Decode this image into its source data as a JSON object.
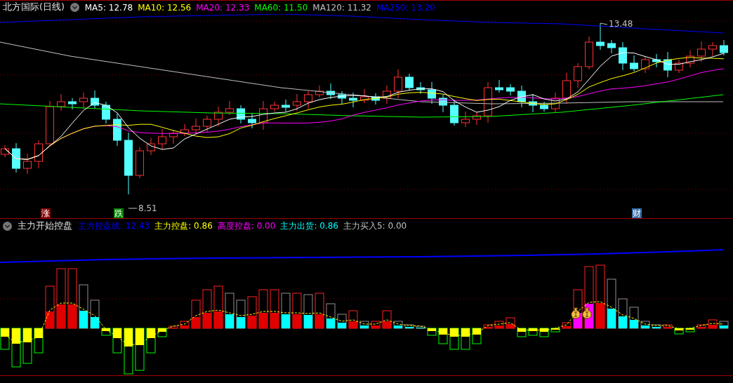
{
  "price_chart": {
    "title": "北方国际(日线)",
    "moving_averages": [
      {
        "label": "MA5: 12.78",
        "color": "#ffffff"
      },
      {
        "label": "MA10: 12.56",
        "color": "#ffff00"
      },
      {
        "label": "MA20: 12.33",
        "color": "#ff00ff"
      },
      {
        "label": "MA60: 11.50",
        "color": "#00ff00"
      },
      {
        "label": "MA120: 11.32",
        "color": "#c0c0c0"
      },
      {
        "label": "MA250: 13.20",
        "color": "#0000ff"
      }
    ],
    "high_label": "13.48",
    "low_label": "8.51",
    "signals": [
      {
        "text": "涨",
        "color": "#8b0000"
      },
      {
        "text": "跌",
        "color": "#008000"
      },
      {
        "text": "财",
        "color": "#3a6ea5"
      }
    ]
  },
  "indicator": {
    "title": "主力开始控盘",
    "values": [
      {
        "label": "主力控盘线: 12.43",
        "color": "#0000ff"
      },
      {
        "label": "主力控盘: 0.86",
        "color": "#ffff00"
      },
      {
        "label": "高度控盘: 0.00",
        "color": "#ff00ff"
      },
      {
        "label": "主力出货: 0.86",
        "color": "#00ffff"
      },
      {
        "label": "主力买入5: 0.00",
        "color": "#c0c0c0"
      }
    ]
  }
}
